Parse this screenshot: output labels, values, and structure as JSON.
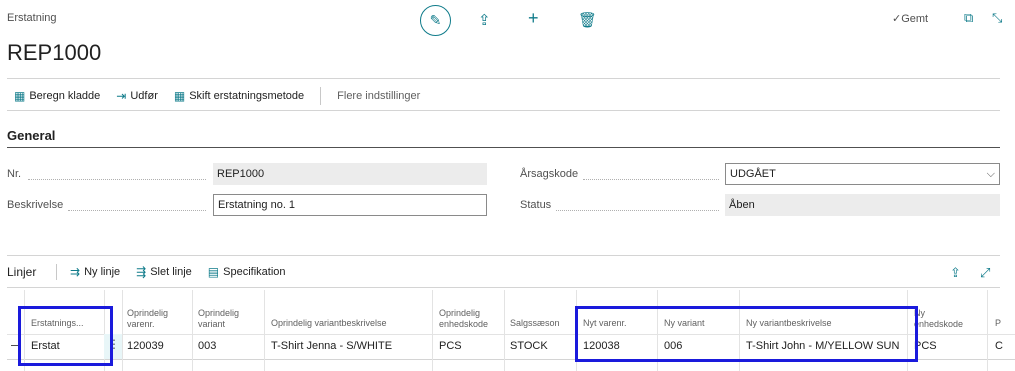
{
  "header": {
    "breadcrumb": "Erstatning",
    "title": "REP1000",
    "saved_label": "Gemt"
  },
  "actions": {
    "beregn_kladde": "Beregn kladde",
    "udfor": "Udfør",
    "skift_metode": "Skift erstatningsmetode",
    "flere": "Flere indstillinger"
  },
  "general": {
    "section_title": "General",
    "nr_label": "Nr.",
    "nr_value": "REP1000",
    "beskrivelse_label": "Beskrivelse",
    "beskrivelse_value": "Erstatning no. 1",
    "arsagskode_label": "Årsagskode",
    "arsagskode_value": "UDGÅET",
    "status_label": "Status",
    "status_value": "Åben"
  },
  "lines": {
    "title": "Linjer",
    "ny_linje": "Ny linje",
    "slet_linje": "Slet linje",
    "specifikation": "Specifikation",
    "columns": {
      "erstatnings": "Erstatnings...",
      "opr_varenr_1": "Oprindelig",
      "opr_varenr_2": "varenr.",
      "opr_variant_1": "Oprindelig",
      "opr_variant_2": "variant",
      "opr_variantbeskr": "Oprindelig variantbeskrivelse",
      "opr_enhed_1": "Oprindelig",
      "opr_enhed_2": "enhedskode",
      "salgssaeson": "Salgssæson",
      "nyt_varenr": "Nyt varenr.",
      "ny_variant": "Ny variant",
      "ny_variantbeskr": "Ny variantbeskrivelse",
      "ny_enhed_1": "Ny",
      "ny_enhed_2": "enhedskode",
      "cut": "P"
    },
    "row": {
      "erstatnings": "Erstat",
      "opr_varenr": "120039",
      "opr_variant": "003",
      "opr_variantbeskr": "T-Shirt Jenna - S/WHITE",
      "opr_enhed": "PCS",
      "salgssaeson": "STOCK",
      "nyt_varenr": "120038",
      "ny_variant": "006",
      "ny_variantbeskr": "T-Shirt John - M/YELLOW SUN",
      "ny_enhed": "PCS",
      "cut": "C"
    }
  },
  "colors": {
    "accent": "#0f7b8a",
    "highlight": "#1a1adc"
  }
}
